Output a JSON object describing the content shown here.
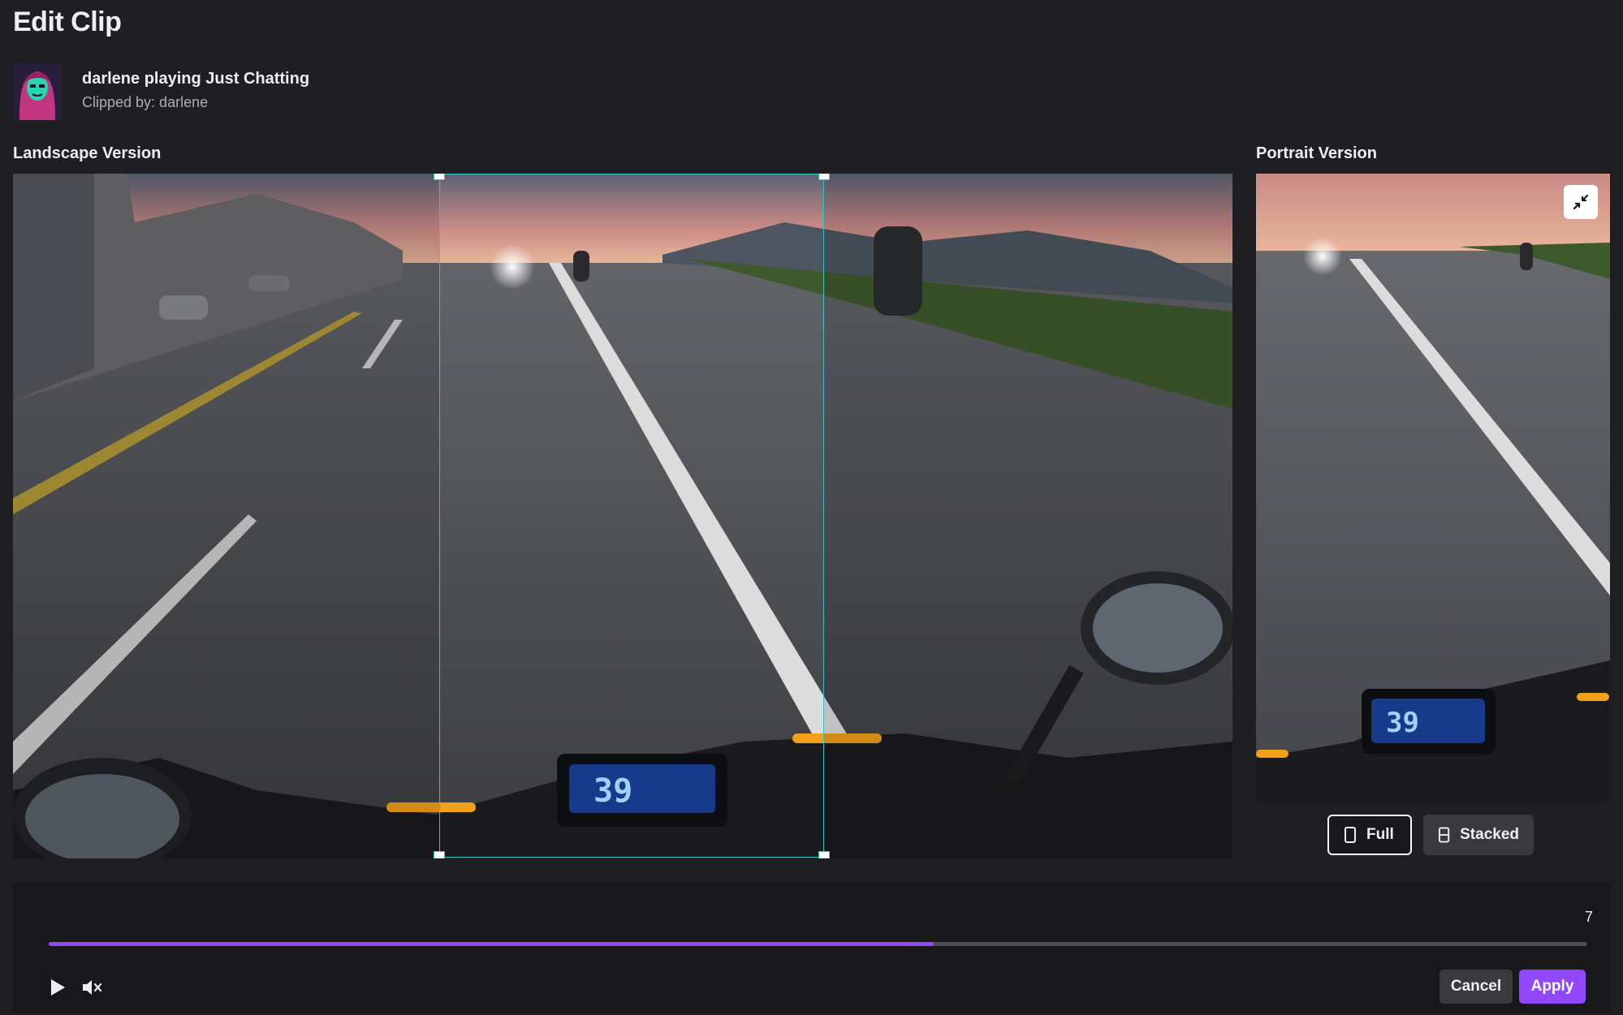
{
  "header": {
    "title": "Edit Clip"
  },
  "clip": {
    "title": "darlene playing Just Chatting",
    "clipped_by": "Clipped by: darlene"
  },
  "landscape": {
    "label": "Landscape Version"
  },
  "portrait": {
    "label": "Portrait Version"
  },
  "speedometer": {
    "reading": "39"
  },
  "layout_options": [
    {
      "label": "Full",
      "icon": "portrait-rect-icon",
      "selected": true
    },
    {
      "label": "Stacked",
      "icon": "stacked-rect-icon",
      "selected": false
    }
  ],
  "timeline": {
    "time": "7",
    "progress_fraction": 0.575
  },
  "controls": {
    "cancel_label": "Cancel",
    "apply_label": "Apply"
  },
  "colors": {
    "accent": "#9147ff",
    "crop_outline": "#2fc5c1",
    "background": "#1f1f23"
  }
}
